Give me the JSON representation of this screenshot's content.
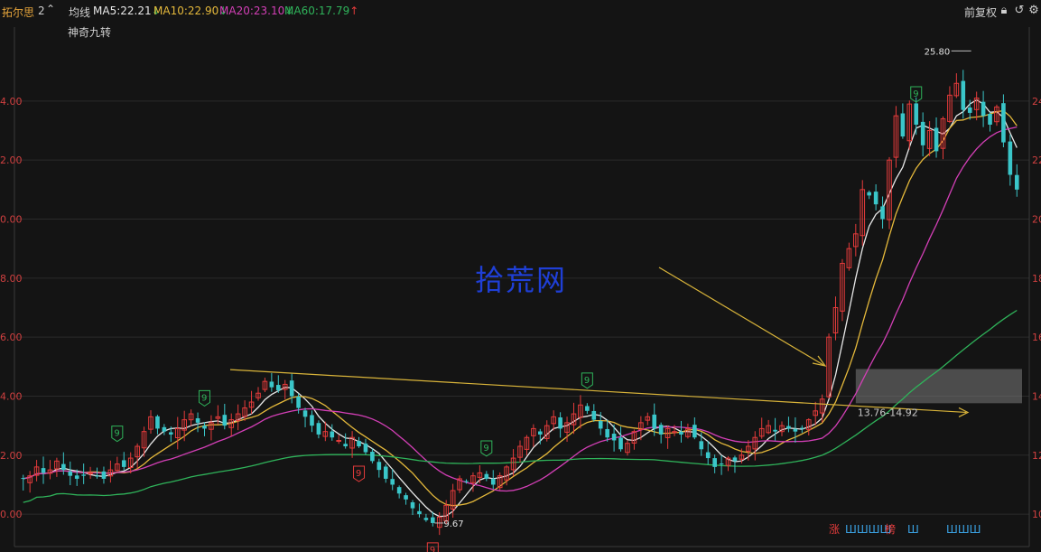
{
  "header": {
    "stock_name": "拓尔思",
    "period": "2",
    "ma_label": "均线",
    "ma5": "MA5:22.21",
    "ma10": "MA10:22.90",
    "ma20": "MA20:23.10",
    "ma60": "MA60:17.79",
    "adjust_label": "前复权",
    "indicator": "神奇九转"
  },
  "watermark": "拾荒网",
  "colors": {
    "up": "#e53b3b",
    "down": "#3ac6c9",
    "ma5": "#e8e8e8",
    "ma10": "#e5b93b",
    "ma20": "#d33fb6",
    "ma60": "#2fb35a",
    "nine_up": "#2fb35a",
    "nine_down": "#e53b3b"
  },
  "chart_data": {
    "type": "candlestick",
    "left_axis_ticks": [
      "4.00",
      "2.00",
      "0.00",
      "8.00",
      "6.00",
      "4.00",
      "2.00",
      "0.00"
    ],
    "right_axis_ticks": [
      "24",
      "22",
      "20",
      "18",
      "16",
      "14",
      "12",
      "10"
    ],
    "ylim": [
      9.3,
      26.2
    ],
    "high_label": "25.80",
    "low_label": "9.67",
    "zone_label": "13.76-14.92",
    "zone": [
      13.76,
      14.92
    ],
    "trendline": [
      [
        0.0,
        14.9
      ],
      [
        1.0,
        13.45
      ]
    ],
    "bottom_marks": [
      "涨",
      "ШШШШ",
      "榜",
      "Ш",
      "ШШШ"
    ],
    "closes": [
      11.2,
      11.3,
      11.6,
      11.4,
      11.5,
      11.8,
      11.5,
      11.3,
      11.2,
      11.3,
      11.4,
      11.3,
      11.2,
      11.5,
      11.7,
      11.6,
      11.9,
      12.3,
      12.8,
      13.3,
      12.9,
      12.8,
      12.7,
      12.9,
      13.2,
      13.4,
      13.1,
      12.9,
      13.1,
      13.3,
      13.0,
      13.2,
      13.4,
      13.6,
      13.8,
      14.1,
      14.5,
      14.3,
      14.2,
      14.4,
      14.0,
      13.6,
      13.3,
      13.0,
      12.7,
      12.8,
      12.6,
      12.5,
      12.3,
      12.6,
      12.3,
      12.1,
      11.8,
      11.5,
      11.2,
      11.0,
      10.7,
      10.5,
      10.2,
      10.0,
      9.8,
      9.7,
      9.9,
      10.3,
      10.8,
      11.2,
      11.1,
      11.3,
      11.4,
      11.2,
      11.0,
      11.3,
      11.6,
      11.9,
      12.3,
      12.6,
      12.9,
      12.7,
      13.0,
      13.3,
      12.9,
      13.1,
      13.4,
      13.7,
      13.5,
      13.2,
      12.9,
      12.6,
      12.5,
      12.2,
      12.4,
      12.8,
      13.1,
      13.3,
      12.9,
      12.7,
      12.9,
      12.8,
      12.7,
      12.9,
      12.6,
      12.2,
      11.9,
      11.6,
      11.7,
      11.9,
      11.8,
      12.0,
      12.3,
      12.6,
      12.9,
      13.0,
      12.8,
      13.0,
      12.9,
      12.8,
      12.9,
      13.2,
      13.5,
      13.9,
      16.0,
      17.0,
      18.5,
      19.0,
      19.5,
      21.0,
      20.8,
      20.5,
      20.0,
      22.0,
      23.5,
      22.8,
      23.9,
      23.2,
      22.5,
      23.0,
      22.3,
      23.4,
      24.2,
      24.6,
      23.7,
      23.6,
      24.1,
      23.5,
      23.2,
      23.8,
      22.6,
      21.5,
      21.0
    ],
    "nine_markers": [
      {
        "label": "9",
        "index": 14,
        "kind": "up"
      },
      {
        "label": "9",
        "index": 27,
        "kind": "up"
      },
      {
        "label": "9",
        "index": 50,
        "kind": "down"
      },
      {
        "label": "9",
        "index": 61,
        "kind": "down"
      },
      {
        "label": "9",
        "index": 69,
        "kind": "up"
      },
      {
        "label": "9",
        "index": 84,
        "kind": "up"
      },
      {
        "label": "9",
        "index": 133,
        "kind": "up"
      },
      {
        "label": "9",
        "index": 155,
        "kind": "down"
      }
    ]
  }
}
